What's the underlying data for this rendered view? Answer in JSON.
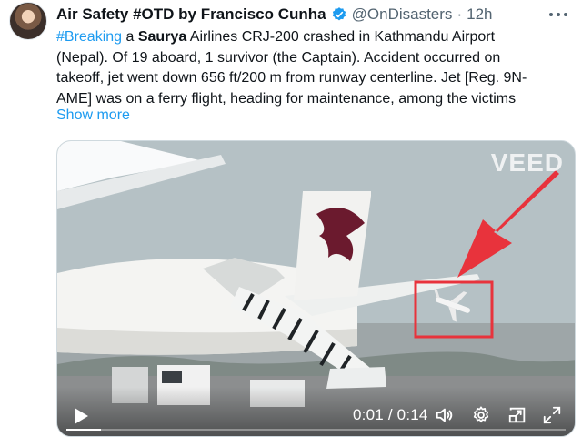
{
  "tweet": {
    "author_name": "Air Safety #OTD by Francisco Cunha",
    "handle": "@OnDisasters",
    "separator": "·",
    "time": "12h",
    "text": {
      "line1": {
        "hashtag": "#Breaking",
        "pre": " a ",
        "bold": "Saurya",
        "post": " Airlines CRJ-200 crashed in Kathmandu Airport"
      },
      "line2": "(Nepal). Of 19 aboard, 1 survivor (the Captain). Accident occurred on",
      "line3": "takeoff, jet went down 656 ft/200 m from runway centerline. Jet [Reg. 9N-",
      "line4": "AME] was on a ferry flight, heading for maintenance, among the victims"
    },
    "show_more": "Show more"
  },
  "media": {
    "watermark": "VEED",
    "current_time": "0:01",
    "duration": "0:14",
    "time_separator": " / ",
    "progress": 0.07,
    "icons": [
      "play-icon",
      "volume-icon",
      "settings-gear-icon",
      "picture-in-picture-icon",
      "fullscreen-icon"
    ]
  },
  "colors": {
    "link": "#1d9bf0",
    "secondary_text": "#536471",
    "annotation_red": "#e8333c",
    "verified": "#1d9bf0"
  }
}
